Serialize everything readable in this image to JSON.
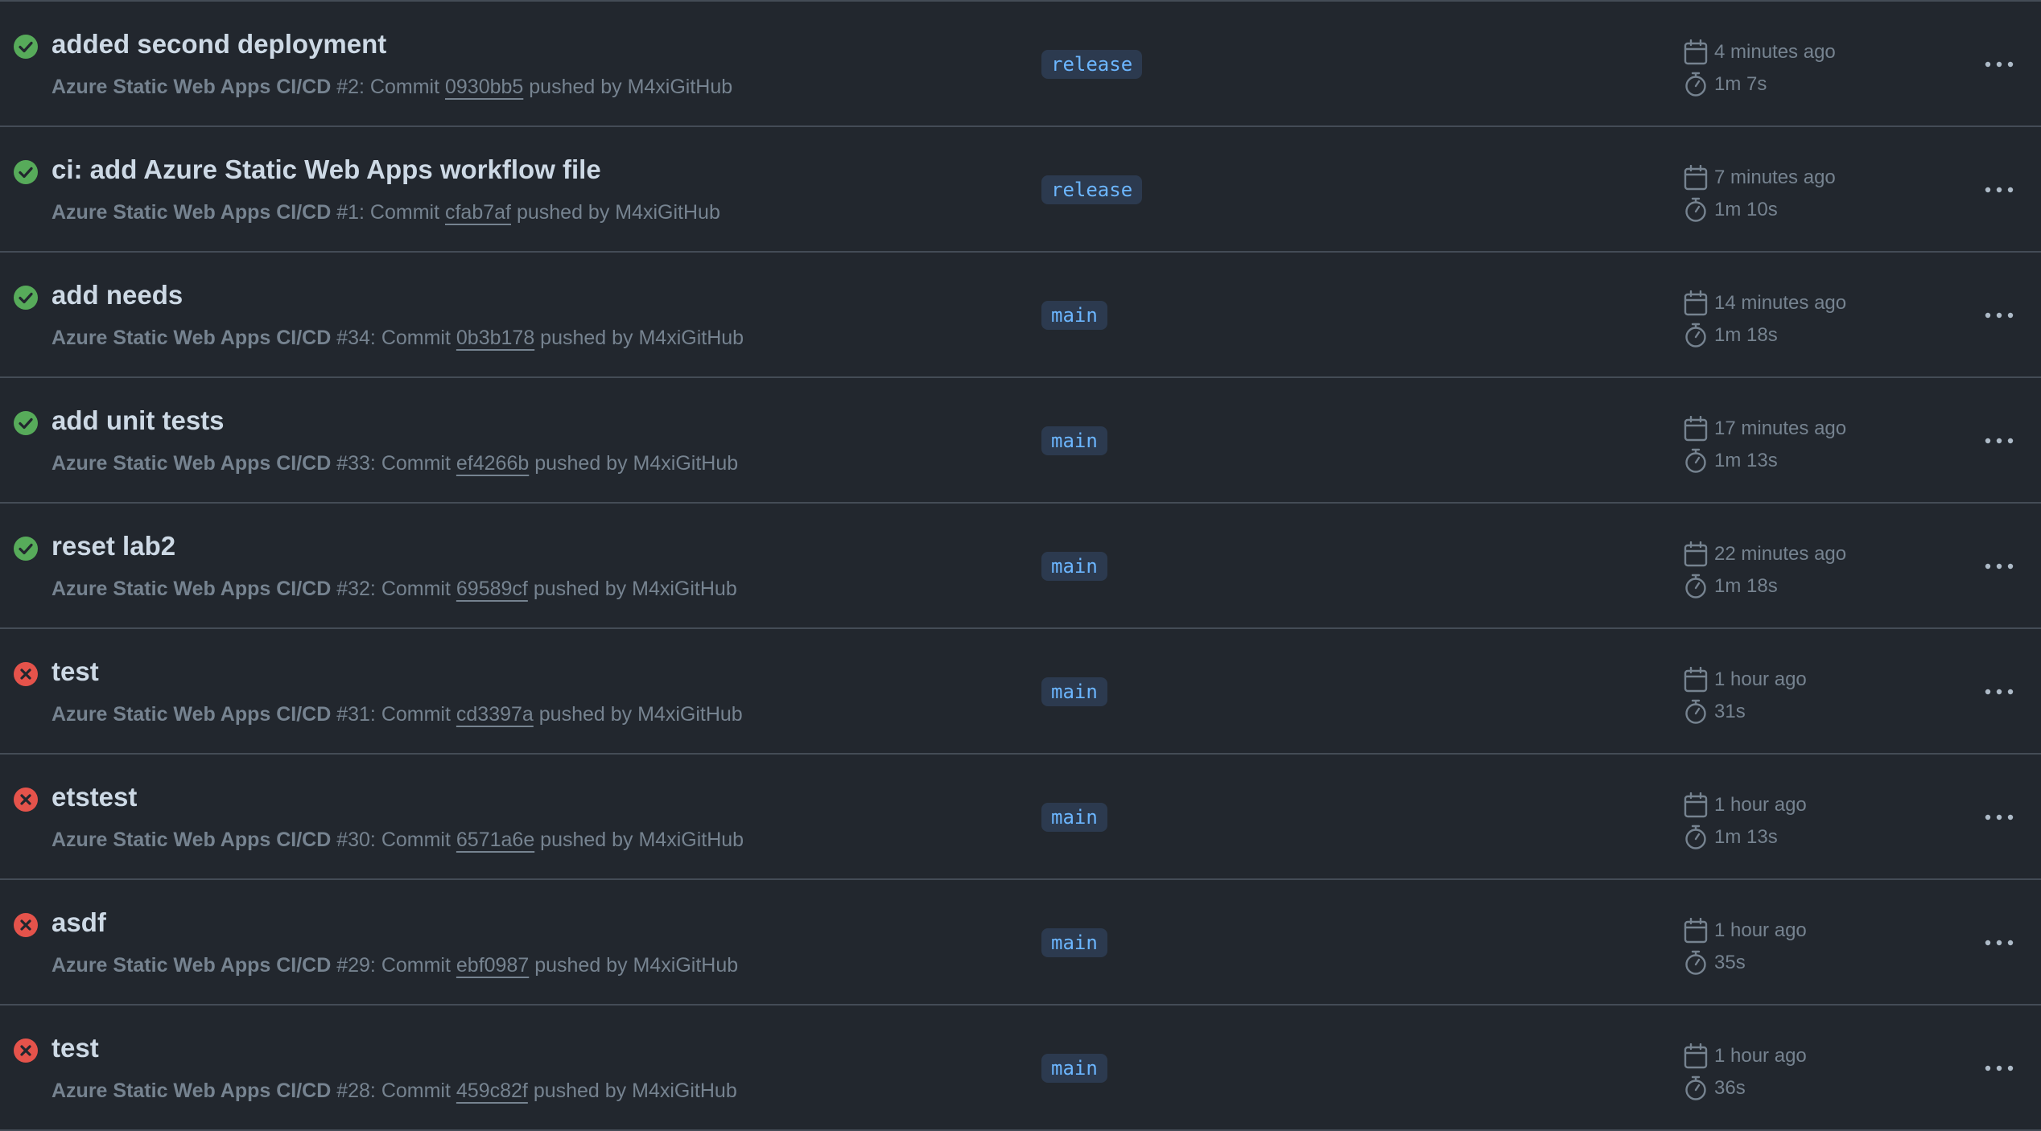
{
  "colors": {
    "background": "#22272e",
    "success": "#57ab5a",
    "failure": "#e5534b",
    "branch_text": "#6cb6ff",
    "branch_bg": "#2c3a4f"
  },
  "runs": [
    {
      "status": "success",
      "status_icon": "check-circle-icon",
      "title": "added second deployment",
      "workflow": "Azure Static Web Apps CI/CD",
      "run_text": "#2: Commit",
      "commit": "0930bb5",
      "pushed_by": "pushed by M4xiGitHub",
      "branch": "release",
      "time_ago": "4 minutes ago",
      "duration": "1m 7s"
    },
    {
      "status": "success",
      "status_icon": "check-circle-icon",
      "title": "ci: add Azure Static Web Apps workflow file",
      "workflow": "Azure Static Web Apps CI/CD",
      "run_text": "#1: Commit",
      "commit": "cfab7af",
      "pushed_by": "pushed by M4xiGitHub",
      "branch": "release",
      "time_ago": "7 minutes ago",
      "duration": "1m 10s"
    },
    {
      "status": "success",
      "status_icon": "check-circle-icon",
      "title": "add needs",
      "workflow": "Azure Static Web Apps CI/CD",
      "run_text": "#34: Commit",
      "commit": "0b3b178",
      "pushed_by": "pushed by M4xiGitHub",
      "branch": "main",
      "time_ago": "14 minutes ago",
      "duration": "1m 18s"
    },
    {
      "status": "success",
      "status_icon": "check-circle-icon",
      "title": "add unit tests",
      "workflow": "Azure Static Web Apps CI/CD",
      "run_text": "#33: Commit",
      "commit": "ef4266b",
      "pushed_by": "pushed by M4xiGitHub",
      "branch": "main",
      "time_ago": "17 minutes ago",
      "duration": "1m 13s"
    },
    {
      "status": "success",
      "status_icon": "check-circle-icon",
      "title": "reset lab2",
      "workflow": "Azure Static Web Apps CI/CD",
      "run_text": "#32: Commit",
      "commit": "69589cf",
      "pushed_by": "pushed by M4xiGitHub",
      "branch": "main",
      "time_ago": "22 minutes ago",
      "duration": "1m 18s"
    },
    {
      "status": "failure",
      "status_icon": "x-circle-icon",
      "title": "test",
      "workflow": "Azure Static Web Apps CI/CD",
      "run_text": "#31: Commit",
      "commit": "cd3397a",
      "pushed_by": "pushed by M4xiGitHub",
      "branch": "main",
      "time_ago": "1 hour ago",
      "duration": "31s"
    },
    {
      "status": "failure",
      "status_icon": "x-circle-icon",
      "title": "etstest",
      "workflow": "Azure Static Web Apps CI/CD",
      "run_text": "#30: Commit",
      "commit": "6571a6e",
      "pushed_by": "pushed by M4xiGitHub",
      "branch": "main",
      "time_ago": "1 hour ago",
      "duration": "1m 13s"
    },
    {
      "status": "failure",
      "status_icon": "x-circle-icon",
      "title": "asdf",
      "workflow": "Azure Static Web Apps CI/CD",
      "run_text": "#29: Commit",
      "commit": "ebf0987",
      "pushed_by": "pushed by M4xiGitHub",
      "branch": "main",
      "time_ago": "1 hour ago",
      "duration": "35s"
    },
    {
      "status": "failure",
      "status_icon": "x-circle-icon",
      "title": "test",
      "workflow": "Azure Static Web Apps CI/CD",
      "run_text": "#28: Commit",
      "commit": "459c82f",
      "pushed_by": "pushed by M4xiGitHub",
      "branch": "main",
      "time_ago": "1 hour ago",
      "duration": "36s"
    }
  ]
}
